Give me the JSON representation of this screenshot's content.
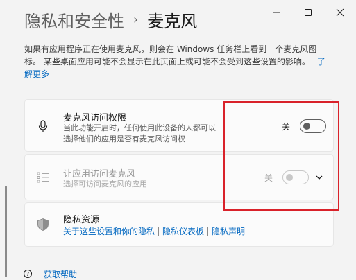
{
  "breadcrumb": {
    "parent": "隐私和安全性",
    "separator": "›",
    "current": "麦克风"
  },
  "description": {
    "text": "如果有应用程序正在使用麦克风，则会在 Windows 任务栏上看到一个麦克风图标。 某些桌面应用可能不会显示在此页面上或可能不会受到这些设置的影响。",
    "link": "了解更多"
  },
  "mic_access": {
    "title": "麦克风访问权限",
    "subtitle": "当此功能开启时，任何使用此设备的人都可以选择他们的应用是否有麦克风访问权",
    "toggle_state": "关",
    "icon": "microphone-icon"
  },
  "app_access": {
    "title": "让应用访问麦克风",
    "subtitle": "选择可访问麦克风的应用",
    "toggle_state": "关",
    "icon": "list-icon",
    "enabled": false
  },
  "privacy": {
    "title": "隐私资源",
    "icon": "shield-icon",
    "links": [
      "关于这些设置和你的隐私",
      "隐私仪表板",
      "隐私声明"
    ]
  },
  "help": {
    "label": "获取帮助",
    "icon": "help-icon"
  },
  "window_controls": [
    "minimize",
    "maximize",
    "close"
  ],
  "colors": {
    "accent": "#0067c0",
    "highlight": "#d9222a",
    "background": "#f3f3f3"
  }
}
